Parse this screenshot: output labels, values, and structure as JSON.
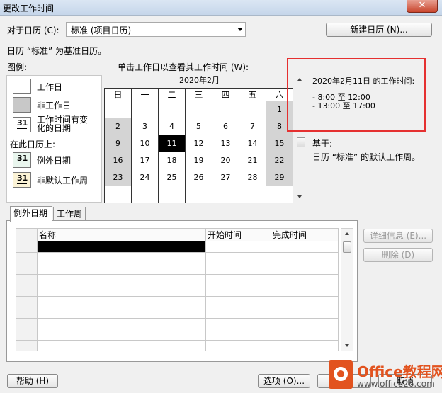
{
  "window": {
    "title": "更改工作时间",
    "close": "✕"
  },
  "calendar_select": {
    "label": "对于日历 (C):",
    "value": "标准 (项目日历)"
  },
  "new_calendar_button": "新建日历 (N)...",
  "base_note": "日历 “标准” 为基准日历。",
  "legend": {
    "title": "图例:",
    "working": "工作日",
    "nonworking": "非工作日",
    "nondefault_line1": "工作时间有变",
    "nondefault_line2": "化的日期",
    "on_this_calendar": "在此日历上:",
    "exception_day": "例外日期",
    "nondefault_week": "非默认工作周",
    "swatch_text": "31"
  },
  "calendar": {
    "instruction": "单击工作日以查看其工作时间 (W):",
    "month": "2020年2月",
    "weekdays": [
      "日",
      "一",
      "二",
      "三",
      "四",
      "五",
      "六"
    ],
    "weeks": [
      [
        "",
        "",
        "",
        "",
        "",
        "",
        "1"
      ],
      [
        "2",
        "3",
        "4",
        "5",
        "6",
        "7",
        "8"
      ],
      [
        "9",
        "10",
        "11",
        "12",
        "13",
        "14",
        "15"
      ],
      [
        "16",
        "17",
        "18",
        "19",
        "20",
        "21",
        "22"
      ],
      [
        "23",
        "24",
        "25",
        "26",
        "27",
        "28",
        "29"
      ],
      [
        "",
        "",
        "",
        "",
        "",
        "",
        ""
      ]
    ],
    "selected_day": "11"
  },
  "working_times": {
    "heading": "2020年2月11日 的工作时间:",
    "ranges": [
      "- 8:00 至 12:00",
      "- 13:00 至 17:00"
    ]
  },
  "based_on": {
    "label": "基于:",
    "text": "日历 “标准” 的默认工作周。"
  },
  "tabs": [
    "例外日期",
    "工作周"
  ],
  "grid": {
    "columns": [
      "名称",
      "开始时间",
      "完成时间"
    ],
    "row_count": 10
  },
  "side_buttons": {
    "details": "详细信息 (E)...",
    "delete": "删除 (D)"
  },
  "footer": {
    "help": "帮助 (H)",
    "options": "选项 (O)...",
    "ok": "确定",
    "cancel": "取消"
  },
  "watermark": {
    "brand": "Office教程网",
    "url": "www.office26.com"
  },
  "colors": {
    "nonworking": "#d4d4d4",
    "selected": "#000000",
    "highlight_box": "#e53030",
    "brand": "#e2531f"
  }
}
